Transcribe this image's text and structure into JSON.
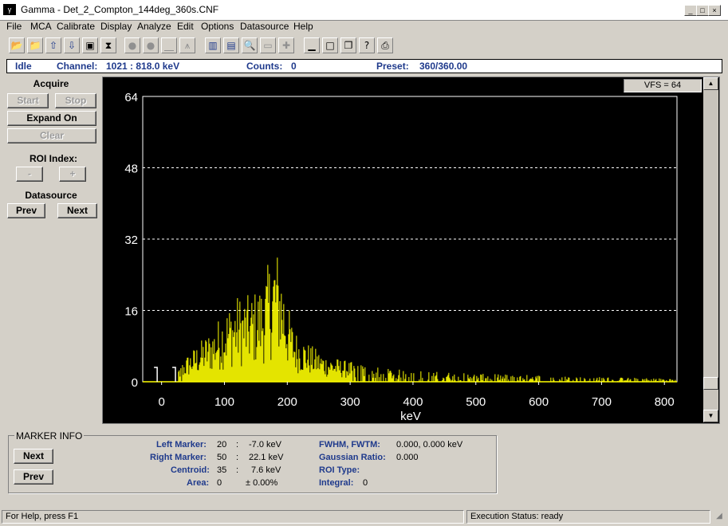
{
  "window": {
    "title": "Gamma - Det_2_Compton_144deg_360s.CNF",
    "icon_label": "γ"
  },
  "menu": [
    "File",
    "MCA",
    "Calibrate",
    "Display",
    "Analyze",
    "Edit",
    "Options",
    "Datasource",
    "Help"
  ],
  "status_strip": {
    "state": "Idle",
    "channel_label": "Channel:",
    "channel_value": "1021   :   818.0 keV",
    "counts_label": "Counts:",
    "counts_value": "0",
    "preset_label": "Preset:",
    "preset_value": "360/360.00"
  },
  "left_panel": {
    "acquire_label": "Acquire",
    "start": "Start",
    "stop": "Stop",
    "expand": "Expand On",
    "clear": "Clear",
    "roi_label": "ROI Index:",
    "roi_minus": "-",
    "roi_plus": "+",
    "datasource_label": "Datasource",
    "prev": "Prev",
    "next": "Next"
  },
  "vfs": "VFS = 64",
  "chart_data": {
    "type": "bar",
    "xlabel": "keV",
    "ylabel": "",
    "title": "",
    "xlim": [
      -30,
      820
    ],
    "ylim": [
      0,
      64
    ],
    "x_ticks": [
      "0",
      "100",
      "200",
      "300",
      "400",
      "500",
      "600",
      "700",
      "800"
    ],
    "y_ticks": [
      "0",
      "16",
      "32",
      "48",
      "64"
    ],
    "bar_color": "#ffff00",
    "grid": "horizontal dashed",
    "markers": [
      -7.0,
      22.1
    ],
    "envelope": [
      [
        25,
        2
      ],
      [
        40,
        4
      ],
      [
        60,
        6
      ],
      [
        80,
        8
      ],
      [
        100,
        11
      ],
      [
        120,
        13
      ],
      [
        140,
        13
      ],
      [
        160,
        15
      ],
      [
        170,
        18
      ],
      [
        180,
        21
      ],
      [
        190,
        18
      ],
      [
        200,
        12
      ],
      [
        210,
        8
      ],
      [
        230,
        6
      ],
      [
        260,
        4
      ],
      [
        300,
        3
      ],
      [
        350,
        2
      ],
      [
        420,
        1.6
      ],
      [
        500,
        1.2
      ],
      [
        600,
        1
      ],
      [
        700,
        0.7
      ],
      [
        800,
        0.5
      ],
      [
        818,
        0.4
      ]
    ]
  },
  "marker_info": {
    "title": "MARKER INFO",
    "next": "Next",
    "prev": "Prev",
    "left_marker_label": "Left Marker:",
    "left_marker_ch": "20",
    "left_marker_sep": ":",
    "left_marker_kev": "-7.0 keV",
    "right_marker_label": "Right Marker:",
    "right_marker_ch": "50",
    "right_marker_sep": ":",
    "right_marker_kev": "22.1 keV",
    "centroid_label": "Centroid:",
    "centroid_ch": "35",
    "centroid_sep": ":",
    "centroid_kev": "7.6 keV",
    "area_label": "Area:",
    "area_value": "0",
    "area_pct": "± 0.00%",
    "fwhm_label": "FWHM, FWTM:",
    "fwhm_value": "0.000, 0.000 keV",
    "gauss_label": "Gaussian Ratio:",
    "gauss_value": "0.000",
    "roi_type_label": "ROI Type:",
    "integral_label": "Integral:",
    "integral_value": "0"
  },
  "statusbar": {
    "help": "For Help, press F1",
    "exec": "Execution Status: ready"
  }
}
